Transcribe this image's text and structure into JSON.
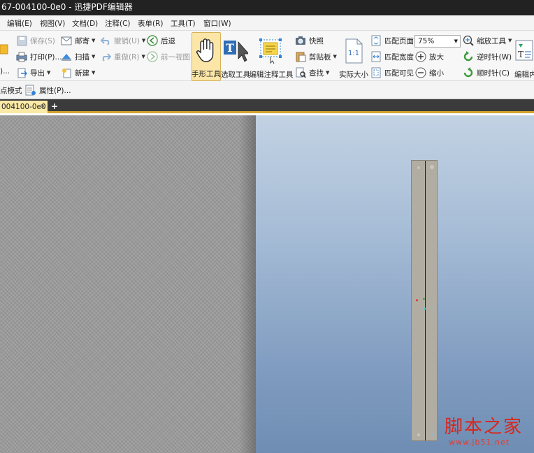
{
  "window": {
    "title": "67-004100-0e0 - 迅捷PDF编辑器"
  },
  "menu": [
    "编辑(E)",
    "视图(V)",
    "文档(D)",
    "注释(C)",
    "表单(R)",
    "工具(T)",
    "窗口(W)"
  ],
  "ribbon": {
    "col1": {
      "save": "保存(S)",
      "print": "打印(P)...",
      "export": "导出"
    },
    "col2": {
      "mail": "邮寄",
      "scan": "扫描",
      "new": "新建"
    },
    "col3": {
      "undo": "撤销(U)",
      "redo": "重做(R)"
    },
    "col4": {
      "back": "后退",
      "prev_view": "前一视图"
    },
    "hand_tool": "手形工具",
    "select_tool": "选取工具",
    "edit_annot_tool": "编辑注释工具",
    "snapshot": "快照",
    "clipboard": "剪贴板",
    "find": "查找",
    "actual_size": "实际大小",
    "fit_page": "匹配页面",
    "fit_width": "匹配宽度",
    "fit_visible": "匹配可见",
    "zoom_value": "75%",
    "zoom_in": "放大",
    "zoom_out": "缩小",
    "zoom_tool": "缩放工具",
    "rotate_ccw": "逆时针(W)",
    "rotate_cw": "顺时针(C)",
    "edit_content": "编辑内",
    "point_mode": "点模式",
    "properties": "属性(P)..."
  },
  "tabs": [
    {
      "label": "004100-0e0"
    }
  ],
  "watermark": {
    "title": "脚本之家",
    "url": "www.jb51.net"
  },
  "colors": {
    "accent_tab": "#fbe9a6",
    "hand_active": "#fbe6a8",
    "tab_border": "#d3a52f"
  }
}
